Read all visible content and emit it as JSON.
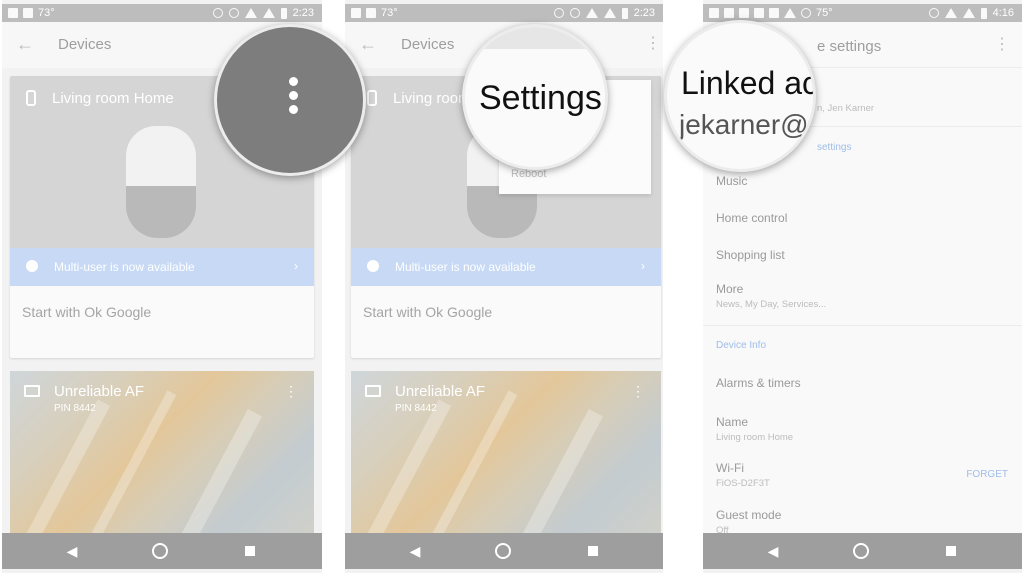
{
  "panels": [
    {
      "status": {
        "left_text": "73°",
        "time": "2:23"
      },
      "appbar": {
        "title": "Devices"
      },
      "home_card": {
        "device_name": "Living room Home",
        "banner_text": "Multi-user is now available",
        "ok_google": "Start with Ok Google"
      },
      "tv_card": {
        "name": "Unreliable AF",
        "pin": "PIN 8442"
      }
    },
    {
      "status": {
        "left_text": "73°",
        "time": "2:23"
      },
      "appbar": {
        "title": "Devices"
      },
      "home_card": {
        "device_name": "Living room Home",
        "banner_text": "Multi-user is now available",
        "ok_google": "Start with Ok Google"
      },
      "tv_card": {
        "name": "Unreliable AF",
        "pin": "PIN 8442"
      },
      "menu": {
        "reboot": "Reboot"
      },
      "magnifier": {
        "text": "Settings"
      }
    },
    {
      "status": {
        "left_text": "75°",
        "time": "4:16"
      },
      "appbar": {
        "title": "e settings"
      },
      "magnifier": {
        "line1": "Linked ac",
        "line2": "jekarner@"
      },
      "linked_name": "n, Jen Karner",
      "section_partial": "settings",
      "items": [
        {
          "title": "Music",
          "subtitle": ""
        },
        {
          "title": "Home control",
          "subtitle": ""
        },
        {
          "title": "Shopping list",
          "subtitle": ""
        },
        {
          "title": "More",
          "subtitle": "News, My Day, Services..."
        }
      ],
      "device_info_header": "Device Info",
      "info_items": [
        {
          "title": "Alarms & timers",
          "subtitle": ""
        },
        {
          "title": "Name",
          "subtitle": "Living room Home"
        },
        {
          "title": "Wi-Fi",
          "subtitle": "FiOS-D2F3T"
        },
        {
          "title": "Guest mode",
          "subtitle": "Off"
        }
      ],
      "forget_label": "FORGET"
    }
  ],
  "icons": {
    "back": "◀",
    "home": "home-circle",
    "recents": "square"
  }
}
